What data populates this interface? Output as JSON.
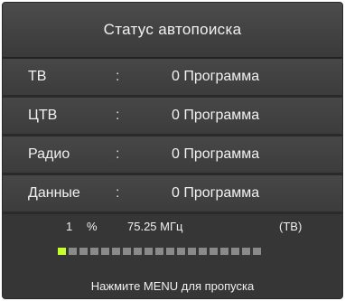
{
  "dialog": {
    "title": "Статус автопоиска"
  },
  "rows": [
    {
      "label": "ТВ",
      "sep": ":",
      "value": "0 Программа"
    },
    {
      "label": "ЦТВ",
      "sep": ":",
      "value": "0 Программа"
    },
    {
      "label": "Радио",
      "sep": ":",
      "value": "0 Программа"
    },
    {
      "label": "Данные",
      "sep": ":",
      "value": "0 Программа"
    }
  ],
  "status": {
    "percent_value": "1",
    "percent_sign": "%",
    "frequency": "75.25 МГц",
    "mode": "(ТВ)"
  },
  "progress": {
    "total_segments": 19,
    "filled_segments": 1,
    "filled_color": "#c6ff2e",
    "empty_color": "#8a8a8a"
  },
  "hint": "Нажмите MENU для пропуска"
}
